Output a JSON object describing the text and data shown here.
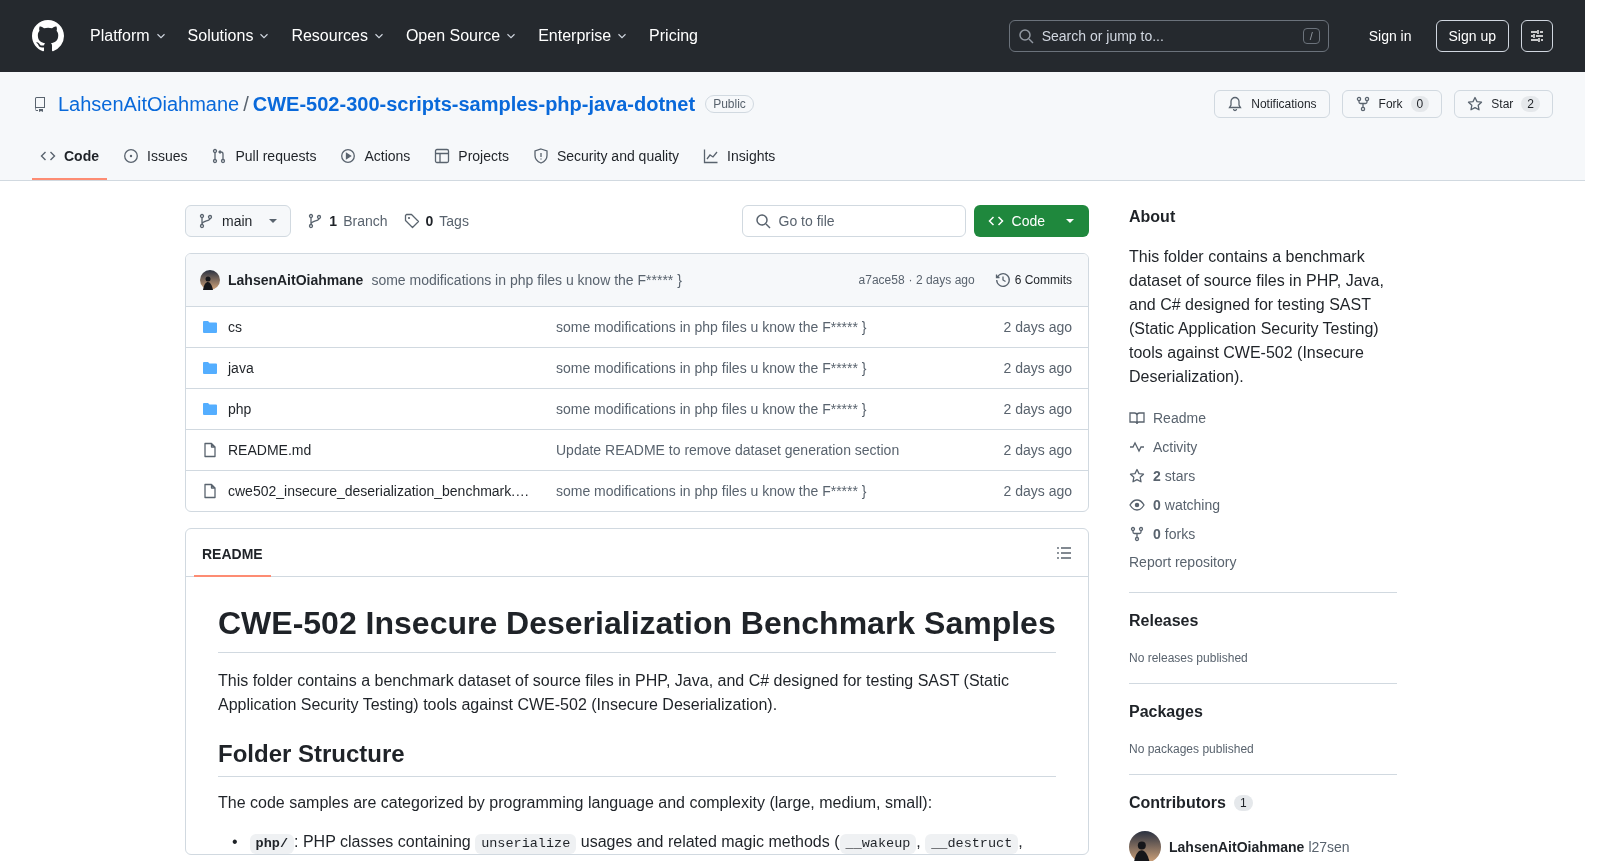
{
  "header": {
    "nav": [
      {
        "label": "Platform",
        "dropdown": true
      },
      {
        "label": "Solutions",
        "dropdown": true
      },
      {
        "label": "Resources",
        "dropdown": true
      },
      {
        "label": "Open Source",
        "dropdown": true
      },
      {
        "label": "Enterprise",
        "dropdown": true
      },
      {
        "label": "Pricing",
        "dropdown": false
      }
    ],
    "search": {
      "placeholder": "Search or jump to...",
      "shortcut": "/"
    },
    "sign_in": "Sign in",
    "sign_up": "Sign up"
  },
  "repo": {
    "owner": "LahsenAitOiahmane",
    "separator": "/",
    "name": "CWE-502-300-scripts-samples-php-java-dotnet",
    "visibility": "Public",
    "actions": [
      {
        "kind": "notifications",
        "label": "Notifications"
      },
      {
        "kind": "fork",
        "label": "Fork",
        "count": "0"
      },
      {
        "kind": "star",
        "label": "Star",
        "count": "2"
      }
    ]
  },
  "tabs": [
    {
      "kind": "code",
      "label": "Code",
      "selected": true
    },
    {
      "kind": "issues",
      "label": "Issues",
      "selected": false
    },
    {
      "kind": "pulls",
      "label": "Pull requests",
      "selected": false
    },
    {
      "kind": "actions",
      "label": "Actions",
      "selected": false
    },
    {
      "kind": "projects",
      "label": "Projects",
      "selected": false
    },
    {
      "kind": "security",
      "label": "Security and quality",
      "selected": false
    },
    {
      "kind": "insights",
      "label": "Insights",
      "selected": false
    }
  ],
  "toolbar": {
    "branch": "main",
    "branches_count": "1",
    "branches_label": "Branch",
    "tags_count": "0",
    "tags_label": "Tags",
    "go_to_file": "Go to file",
    "code_button": "Code"
  },
  "latest_commit": {
    "author": "LahsenAitOiahmane",
    "message": "some modifications in php files u know the F***** }",
    "hash": "a7ace58",
    "time": "· 2 days ago",
    "commits": "6 Commits"
  },
  "files": [
    {
      "kind": "folder",
      "name": "cs",
      "message": "some modifications in php files u know the F***** }",
      "time": "2 days ago"
    },
    {
      "kind": "folder",
      "name": "java",
      "message": "some modifications in php files u know the F***** }",
      "time": "2 days ago"
    },
    {
      "kind": "folder",
      "name": "php",
      "message": "some modifications in php files u know the F***** }",
      "time": "2 days ago"
    },
    {
      "kind": "file",
      "name": "README.md",
      "message": "Update README to remove dataset generation section",
      "time": "2 days ago"
    },
    {
      "kind": "file",
      "name": "cwe502_insecure_deserialization_benchmark.…",
      "message": "some modifications in php files u know the F***** }",
      "time": "2 days ago"
    }
  ],
  "readme": {
    "tab": "README",
    "title": "CWE-502 Insecure Deserialization Benchmark Samples",
    "intro": "This folder contains a benchmark dataset of source files in PHP, Java, and C# designed for testing SAST (Static Application Security Testing) tools against CWE-502 (Insecure Deserialization).",
    "section": "Folder Structure",
    "section_text": "The code samples are categorized by programming language and complexity (large, medium, small):",
    "list": [
      {
        "marker": "•",
        "segments": [
          {
            "kind": "code_bold",
            "text": "php/"
          },
          {
            "kind": "text",
            "text": ": PHP classes containing "
          },
          {
            "kind": "code",
            "text": "unserialize"
          },
          {
            "kind": "text",
            "text": " usages and related magic methods ("
          },
          {
            "kind": "code",
            "text": "__wakeup"
          },
          {
            "kind": "text",
            "text": ", "
          },
          {
            "kind": "code",
            "text": "__destruct"
          },
          {
            "kind": "text",
            "text": ","
          }
        ]
      }
    ]
  },
  "about": {
    "title": "About",
    "description": "This folder contains a benchmark dataset of source files in PHP, Java, and C# designed for testing SAST (Static Application Security Testing) tools against CWE-502 (Insecure Deserialization).",
    "links": [
      {
        "kind": "readme",
        "label": "Readme"
      },
      {
        "kind": "activity",
        "label": "Activity"
      },
      {
        "kind": "stars",
        "count": "2",
        "label": "stars"
      },
      {
        "kind": "watching",
        "count": "0",
        "label": "watching"
      },
      {
        "kind": "forks",
        "count": "0",
        "label": "forks"
      }
    ],
    "report": "Report repository"
  },
  "releases": {
    "title": "Releases",
    "text": "No releases published"
  },
  "packages": {
    "title": "Packages",
    "text": "No packages published"
  },
  "contributors": {
    "title": "Contributors",
    "count": "1",
    "people": [
      {
        "name": "LahsenAitOiahmane",
        "handle": "l27sen"
      }
    ]
  }
}
